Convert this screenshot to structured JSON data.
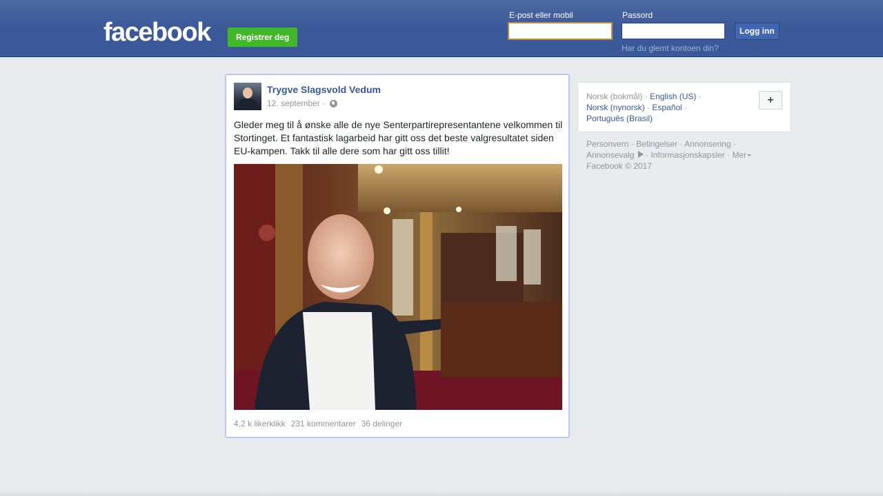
{
  "header": {
    "logo_text": "facebook",
    "register_label": "Registrer deg",
    "email_label": "E-post eller mobil",
    "password_label": "Passord",
    "email_value": "",
    "password_value": "",
    "login_label": "Logg inn",
    "forgot_label": "Har du glemt kontoen din?"
  },
  "post": {
    "author": "Trygve Slagsvold Vedum",
    "date": "12. september ·",
    "privacy_icon": "globe-icon",
    "text": "Gleder meg til å ønske alle de nye Senterpartirepresentantene velkommen til Stortinget. Et fantastisk lagarbeid har gitt oss det beste valgresultatet siden EU-kampen. Takk til alle dere som har gitt oss tillit!",
    "likes": "4,2 k likerklikk",
    "comments": "231 kommentarer",
    "shares": "36 delinger"
  },
  "languages": {
    "current": "Norsk (bokmål)",
    "options": [
      "English (US)",
      "Norsk (nynorsk)",
      "Español",
      "Português (Brasil)"
    ],
    "add_label": "+"
  },
  "footer": {
    "links": [
      "Personvern",
      "Betingelser",
      "Annonsering",
      "Annonsevalg",
      "Informasjonskapsler",
      "Mer"
    ],
    "copyright": "Facebook © 2017"
  },
  "colors": {
    "brand_blue": "#3b5998",
    "register_green": "#42b72a",
    "link_blue": "#365899",
    "page_bg": "#e9ebee"
  }
}
